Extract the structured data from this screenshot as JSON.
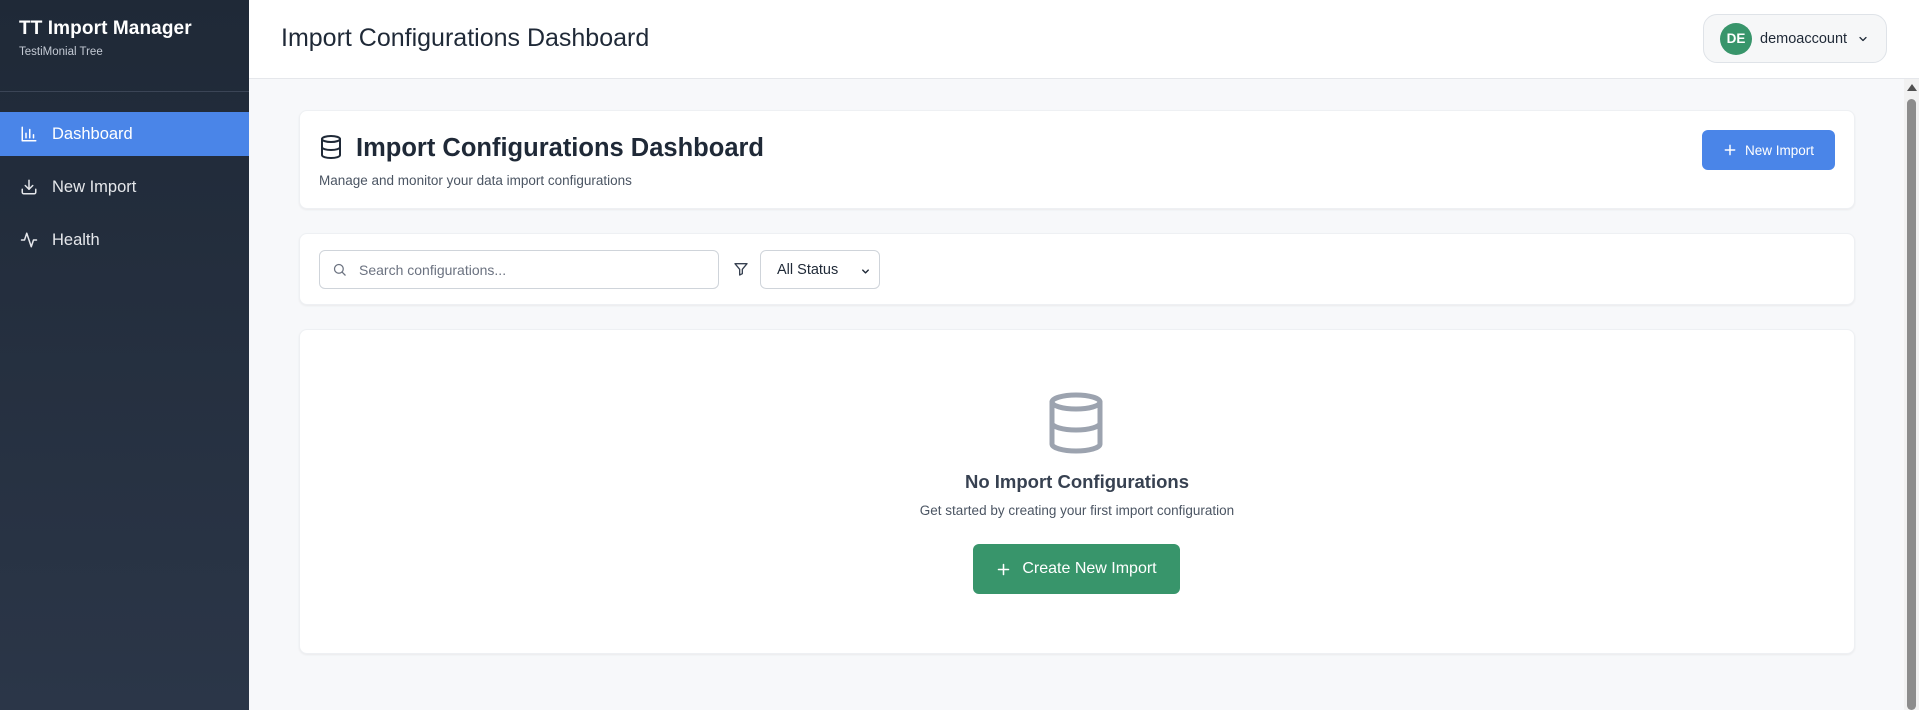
{
  "brand": {
    "title": "TT Import Manager",
    "subtitle": "TestiMonial Tree"
  },
  "sidebar": {
    "items": [
      {
        "label": "Dashboard",
        "icon": "bar-chart-icon",
        "active": true
      },
      {
        "label": "New Import",
        "icon": "download-icon",
        "active": false
      },
      {
        "label": "Health",
        "icon": "activity-icon",
        "active": false
      }
    ]
  },
  "header": {
    "title": "Import Configurations Dashboard",
    "user": {
      "initials": "DE",
      "name": "demoaccount"
    }
  },
  "main": {
    "title": "Import Configurations Dashboard",
    "description": "Manage and monitor your data import configurations",
    "new_import_label": "New Import",
    "search": {
      "placeholder": "Search configurations...",
      "value": ""
    },
    "status_filter": {
      "selected": "All Status"
    },
    "empty_state": {
      "title": "No Import Configurations",
      "subtitle": "Get started by creating your first import configuration",
      "button_label": "Create New Import"
    }
  },
  "colors": {
    "sidebar_bg": "#1f2937",
    "active_nav": "#4a85e8",
    "primary_button": "#4a85e8",
    "success_button": "#38956b",
    "avatar_bg": "#38956b"
  }
}
